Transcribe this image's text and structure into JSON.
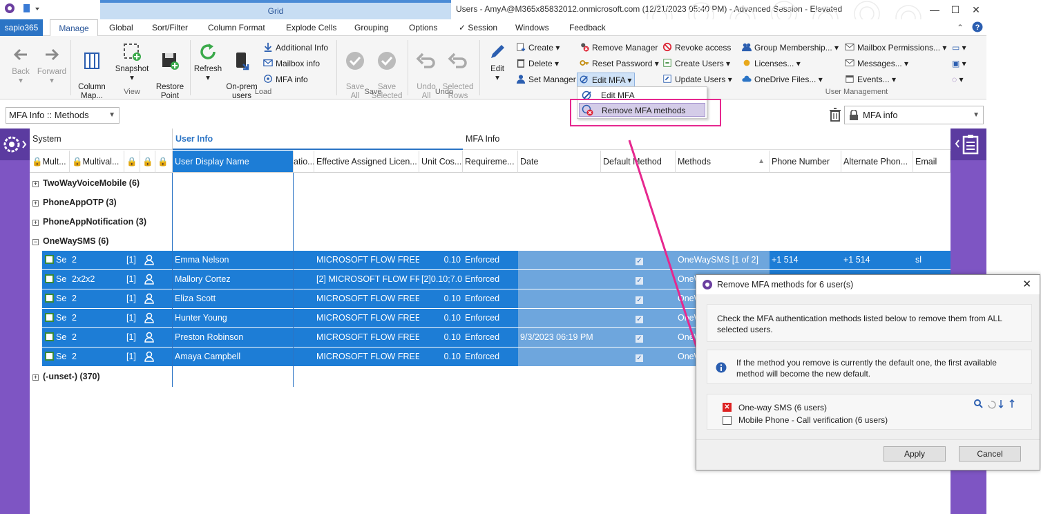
{
  "window": {
    "context_tab": "Grid",
    "title": "Users - AmyA@M365x85832012.onmicrosoft.com (12/21/2023 05:40 PM) - Advanced Session - Elevated"
  },
  "tabs": [
    {
      "label": "sapio365"
    },
    {
      "label": "Manage"
    },
    {
      "label": "Global"
    },
    {
      "label": "Sort/Filter"
    },
    {
      "label": "Column Format"
    },
    {
      "label": "Explode Cells"
    },
    {
      "label": "Grouping"
    },
    {
      "label": "Options"
    },
    {
      "label": "Session"
    },
    {
      "label": "Windows"
    },
    {
      "label": "Feedback"
    }
  ],
  "ribbon": {
    "back": "Back",
    "forward": "Forward",
    "column_map": "Column\nMap...",
    "snapshot": "Snapshot",
    "restore_point": "Restore\nPoint",
    "view_group": "View",
    "refresh": "Refresh",
    "onprem_users": "On-prem\nusers",
    "additional_info": "Additional Info",
    "mailbox_info": "Mailbox info",
    "mfa_info": "MFA info",
    "load_group": "Load",
    "save_all": "Save\nAll",
    "save_selected": "Save\nSelected",
    "save_group": "Save",
    "undo_all": "Undo\nAll",
    "selected_rows": "Selected\nRows",
    "undo_group": "Undo",
    "edit": "Edit",
    "create": "Create",
    "delete": "Delete",
    "set_manager": "Set Manager",
    "remove_manager": "Remove Manager",
    "reset_password": "Reset Password",
    "edit_mfa": "Edit MFA",
    "revoke_access": "Revoke access",
    "create_users": "Create Users",
    "update_users": "Update Users",
    "group_membership": "Group Membership...",
    "licenses": "Licenses...",
    "onedrive_files": "OneDrive Files...",
    "mailbox_permissions": "Mailbox Permissions...",
    "messages": "Messages...",
    "events": "Events...",
    "user_mgmt_group": "User Management"
  },
  "menu": {
    "edit_mfa": "Edit MFA",
    "remove_mfa_methods": "Remove MFA methods"
  },
  "filterbar": {
    "view_combo": "MFA Info :: Methods",
    "right_combo": "MFA info"
  },
  "grid": {
    "bands": {
      "system": "System",
      "user_info": "User Info",
      "mfa_info": "MFA Info"
    },
    "columns": {
      "mult": "Mult...",
      "multival": "Multival...",
      "user_display_name": "User Display Name",
      "atio": "atio...",
      "eff_lic": "Effective Assigned Licen...",
      "unit_cost": "Unit Cos...",
      "requirement": "Requireme...",
      "date": "Date",
      "default_method": "Default Method",
      "methods": "Methods",
      "phone": "Phone Number",
      "alt_phone": "Alternate Phon...",
      "email": "Email"
    },
    "groups": [
      {
        "label": "TwoWayVoiceMobile (6)",
        "expanded": false
      },
      {
        "label": "PhoneAppOTP (3)",
        "expanded": false
      },
      {
        "label": "PhoneAppNotification (3)",
        "expanded": false
      },
      {
        "label": "OneWaySMS (6)",
        "expanded": true
      },
      {
        "label": "(-unset-) (370)",
        "expanded": false
      }
    ],
    "rows": [
      {
        "set": "Se",
        "multival": "2",
        "n": "[1]",
        "name": "Emma Nelson",
        "license": "MICROSOFT FLOW FREE",
        "cost": "0.10",
        "req": "Enforced",
        "date": "",
        "method": "OneWaySMS [1 of 2]",
        "phone": "+1 514",
        "alt": "+1 514",
        "email": "sl"
      },
      {
        "set": "Se",
        "multival": "2x2x2",
        "n": "[1]",
        "name": "Mallory Cortez",
        "license": "[2] MICROSOFT FLOW FR",
        "cost": "[2]0.10;7.0",
        "req": "Enforced",
        "date": "",
        "method": "OneW",
        "phone": "",
        "alt": "",
        "email": ""
      },
      {
        "set": "Se",
        "multival": "2",
        "n": "[1]",
        "name": "Eliza Scott",
        "license": "MICROSOFT FLOW FREE",
        "cost": "0.10",
        "req": "Enforced",
        "date": "",
        "method": "OneW",
        "phone": "",
        "alt": "",
        "email": ""
      },
      {
        "set": "Se",
        "multival": "2",
        "n": "[1]",
        "name": "Hunter Young",
        "license": "MICROSOFT FLOW FREE",
        "cost": "0.10",
        "req": "Enforced",
        "date": "",
        "method": "OneW",
        "phone": "",
        "alt": "",
        "email": ""
      },
      {
        "set": "Se",
        "multival": "2",
        "n": "[1]",
        "name": "Preston Robinson",
        "license": "MICROSOFT FLOW FREE",
        "cost": "0.10",
        "req": "Enforced",
        "date": "9/3/2023 06:19 PM",
        "method": "OneW",
        "phone": "",
        "alt": "",
        "email": ""
      },
      {
        "set": "Se",
        "multival": "2",
        "n": "[1]",
        "name": "Amaya Campbell",
        "license": "MICROSOFT FLOW FREE",
        "cost": "0.10",
        "req": "Enforced",
        "date": "",
        "method": "OneW",
        "phone": "",
        "alt": "",
        "email": ""
      }
    ]
  },
  "dialog": {
    "title": "Remove MFA methods for 6 user(s)",
    "instruction": "Check the MFA authentication methods listed below to remove them from ALL selected users.",
    "info": "If the method you remove is currently the default one, the first available method will become the new default.",
    "methods": [
      {
        "label": "One-way SMS (6 users)",
        "checked": true
      },
      {
        "label": "Mobile Phone - Call verification (6 users)",
        "checked": false
      }
    ],
    "apply": "Apply",
    "cancel": "Cancel"
  },
  "colors": {
    "accent": "#2b74c5",
    "selection": "#1d7dd6",
    "side_panel": "#7e55c3",
    "highlight": "#e6288f"
  }
}
